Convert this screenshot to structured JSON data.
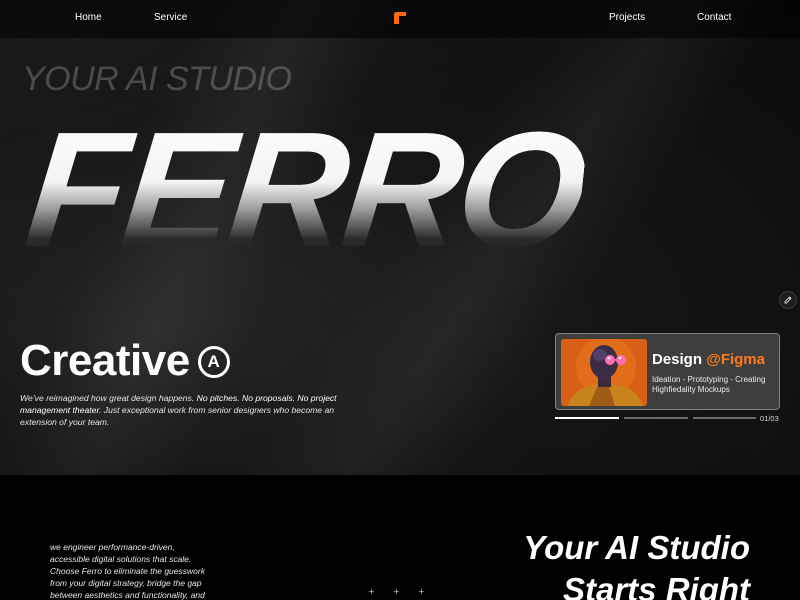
{
  "nav": {
    "home": "Home",
    "service": "Service",
    "projects": "Projects",
    "contact": "Contact",
    "logo_icon": "ferro-logo-icon",
    "logo_color": "#ff6a13"
  },
  "hero": {
    "tagline": "YOUR AI STUDIO",
    "brand": "FERRO",
    "creative_title": "Creative",
    "creative_mark": "A",
    "description_plain": "We’ve reimagined how great design happens.",
    "description_bold": "No pitches. No proposals. No project management theater.",
    "description_end": "Just exceptional work from senior designers who become an extension of your team.",
    "edit_icon": "pencil-icon"
  },
  "card": {
    "title_main": "Design",
    "title_accent": "@Figma",
    "subtitle": "Ideation - Prototyping - Creating Highfiedality Mockups",
    "counter": "01/03",
    "progress_active_index": 1,
    "progress_total": 3,
    "accent_color": "#ff7a1a"
  },
  "section2": {
    "text": "we engineer performance-driven, accessible digital solutions that scale. Choose Ferro to eliminate the guesswork from your digital strategy, bridge the gap between aesthetics and functionality, and",
    "heading_line1": "Your AI Studio",
    "heading_line2": "Starts Right",
    "plus_symbol": "+"
  }
}
